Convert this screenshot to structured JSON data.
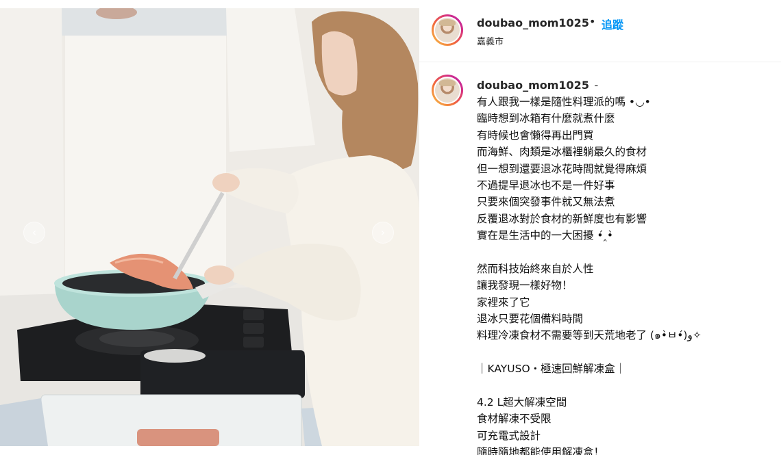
{
  "post": {
    "username": "doubao_mom1025",
    "separator": "•",
    "follow_label": "追蹤",
    "location": "嘉義市",
    "carousel": {
      "prev_icon": "‹",
      "next_icon": "›"
    }
  },
  "caption": {
    "author": "doubao_mom1025",
    "author_suffix": "-",
    "lines": [
      "有人跟我一樣是隨性料理派的嗎 •◡•",
      "臨時想到冰箱有什麼就煮什麼",
      "有時候也會懶得再出門買",
      "而海鮮、肉類是冰櫃裡躺最久的食材",
      "但一想到還要退冰花時間就覺得麻煩",
      "不過提早退冰也不是一件好事",
      "只要來個突發事件就又無法煮",
      "反覆退冰對於食材的新鮮度也有影響",
      "實在是生活中的一大困擾 •́‸•̀",
      "",
      "然而科技始終來自於人性",
      "讓我發現一樣好物！",
      "家裡來了它",
      "退冰只要花個備料時間",
      "料理冷凍食材不需要等到天荒地老了 (๑•̀ㅂ•́)و✧",
      "",
      "｜KAYUSO・極速回鮮解凍盒｜",
      "",
      "4.2 L超大解凍空間",
      "食材解凍不受限",
      "可充電式設計",
      "隨時隨地都能使用解凍盒！"
    ]
  },
  "colors": {
    "link_blue": "#0095f6",
    "text": "#262626",
    "story_ring": [
      "#f7c64a",
      "#d32b86"
    ]
  }
}
